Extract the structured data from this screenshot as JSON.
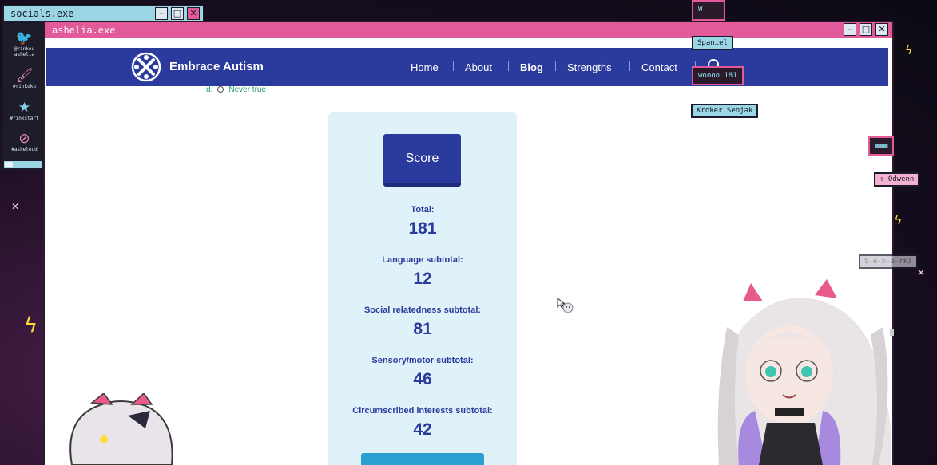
{
  "socials_window": {
    "title": "socials.exe",
    "links": [
      {
        "icon": "twitter-bird-icon",
        "label": "@rinkou\nashelia"
      },
      {
        "icon": "paintbrush-icon",
        "label": "#rinkoku"
      },
      {
        "icon": "star-icon",
        "label": "#rinkstart"
      },
      {
        "icon": "prohibited-icon",
        "label": "#asheleud"
      }
    ]
  },
  "main_window": {
    "title": "ashelia.exe"
  },
  "site": {
    "brand": "Embrace Autism",
    "nav": [
      "Home",
      "About",
      "Blog",
      "Strengths",
      "Contact"
    ],
    "active_nav": "Blog",
    "answer_option_letter": "d.",
    "answer_option_text": "Never true",
    "score_button": "Score",
    "stats": [
      {
        "label": "Total",
        "value": "181"
      },
      {
        "label": "Language subtotal",
        "value": "12"
      },
      {
        "label": "Social relatedness subtotal",
        "value": "81"
      },
      {
        "label": "Sensory/motor subtotal",
        "value": "46"
      },
      {
        "label": "Circumscribed interests subtotal",
        "value": "42"
      }
    ]
  },
  "chat": {
    "messages": [
      {
        "user": "Spaniel",
        "text": "W"
      },
      {
        "user": "Kroker Senjak",
        "text": "woooo 181"
      },
      {
        "user": "Odwenn",
        "text": "▩▩▩"
      }
    ],
    "faded_user": "S-e-n-e-rk3"
  },
  "colors": {
    "header_blue": "#2a3a9d",
    "accent_pink": "#e25a9a",
    "accent_cyan": "#9ad6e4",
    "card_bg": "#dff2f9"
  }
}
